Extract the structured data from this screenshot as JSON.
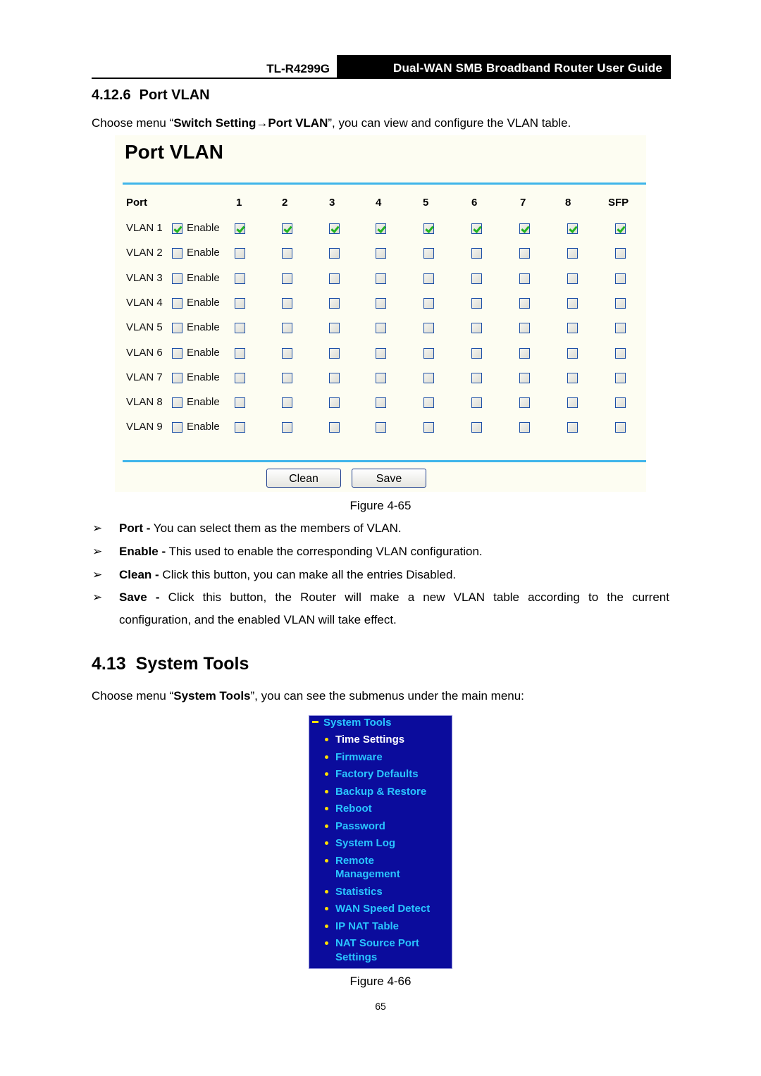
{
  "header": {
    "model": "TL-R4299G",
    "guide_title": "Dual-WAN SMB Broadband Router User Guide"
  },
  "section_port_vlan": {
    "number": "4.12.6",
    "title": "Port VLAN",
    "intro_prefix": "Choose menu “",
    "intro_bold": "Switch Setting→Port VLAN",
    "intro_suffix": "”, you can view and configure the VLAN table."
  },
  "figure_65": {
    "panel_title": "Port VLAN",
    "port_header": "Port",
    "ports": [
      "1",
      "2",
      "3",
      "4",
      "5",
      "6",
      "7",
      "8",
      "SFP"
    ],
    "enable_label": "Enable",
    "vlans": [
      {
        "label": "VLAN 1",
        "enabled": true,
        "members": [
          true,
          true,
          true,
          true,
          true,
          true,
          true,
          true,
          true
        ]
      },
      {
        "label": "VLAN 2",
        "enabled": false,
        "members": [
          false,
          false,
          false,
          false,
          false,
          false,
          false,
          false,
          false
        ]
      },
      {
        "label": "VLAN 3",
        "enabled": false,
        "members": [
          false,
          false,
          false,
          false,
          false,
          false,
          false,
          false,
          false
        ]
      },
      {
        "label": "VLAN 4",
        "enabled": false,
        "members": [
          false,
          false,
          false,
          false,
          false,
          false,
          false,
          false,
          false
        ]
      },
      {
        "label": "VLAN 5",
        "enabled": false,
        "members": [
          false,
          false,
          false,
          false,
          false,
          false,
          false,
          false,
          false
        ]
      },
      {
        "label": "VLAN 6",
        "enabled": false,
        "members": [
          false,
          false,
          false,
          false,
          false,
          false,
          false,
          false,
          false
        ]
      },
      {
        "label": "VLAN 7",
        "enabled": false,
        "members": [
          false,
          false,
          false,
          false,
          false,
          false,
          false,
          false,
          false
        ]
      },
      {
        "label": "VLAN 8",
        "enabled": false,
        "members": [
          false,
          false,
          false,
          false,
          false,
          false,
          false,
          false,
          false
        ]
      },
      {
        "label": "VLAN 9",
        "enabled": false,
        "members": [
          false,
          false,
          false,
          false,
          false,
          false,
          false,
          false,
          false
        ]
      }
    ],
    "buttons": {
      "clean": "Clean",
      "save": "Save"
    },
    "caption": "Figure 4-65"
  },
  "descriptions": [
    {
      "term": "Port -",
      "text": " You can select them as the members of VLAN."
    },
    {
      "term": "Enable -",
      "text": " This used to enable the corresponding VLAN configuration."
    },
    {
      "term": "Clean -",
      "text": " Click this button, you can make all the entries Disabled."
    },
    {
      "term": "Save -",
      "text": " Click this button, the Router will make a new VLAN table according to the current",
      "continuation": "configuration, and the enabled VLAN will take effect."
    }
  ],
  "section_system_tools": {
    "number": "4.13",
    "title": "System Tools",
    "intro_prefix": "Choose menu “",
    "intro_bold": "System Tools",
    "intro_suffix": "”, you can see the submenus under the main menu:"
  },
  "figure_66": {
    "menu_title": "System Tools",
    "items": [
      {
        "lines": [
          "Time Settings"
        ],
        "active": true
      },
      {
        "lines": [
          "Firmware"
        ]
      },
      {
        "lines": [
          "Factory Defaults"
        ]
      },
      {
        "lines": [
          "Backup & Restore"
        ]
      },
      {
        "lines": [
          "Reboot"
        ]
      },
      {
        "lines": [
          "Password"
        ]
      },
      {
        "lines": [
          "System Log"
        ]
      },
      {
        "lines": [
          "Remote",
          "Management"
        ]
      },
      {
        "lines": [
          "Statistics"
        ]
      },
      {
        "lines": [
          "WAN Speed Detect"
        ]
      },
      {
        "lines": [
          "IP NAT Table"
        ]
      },
      {
        "lines": [
          "NAT Source Port",
          "Settings"
        ]
      }
    ],
    "caption": "Figure 4-66"
  },
  "page_number": "65"
}
